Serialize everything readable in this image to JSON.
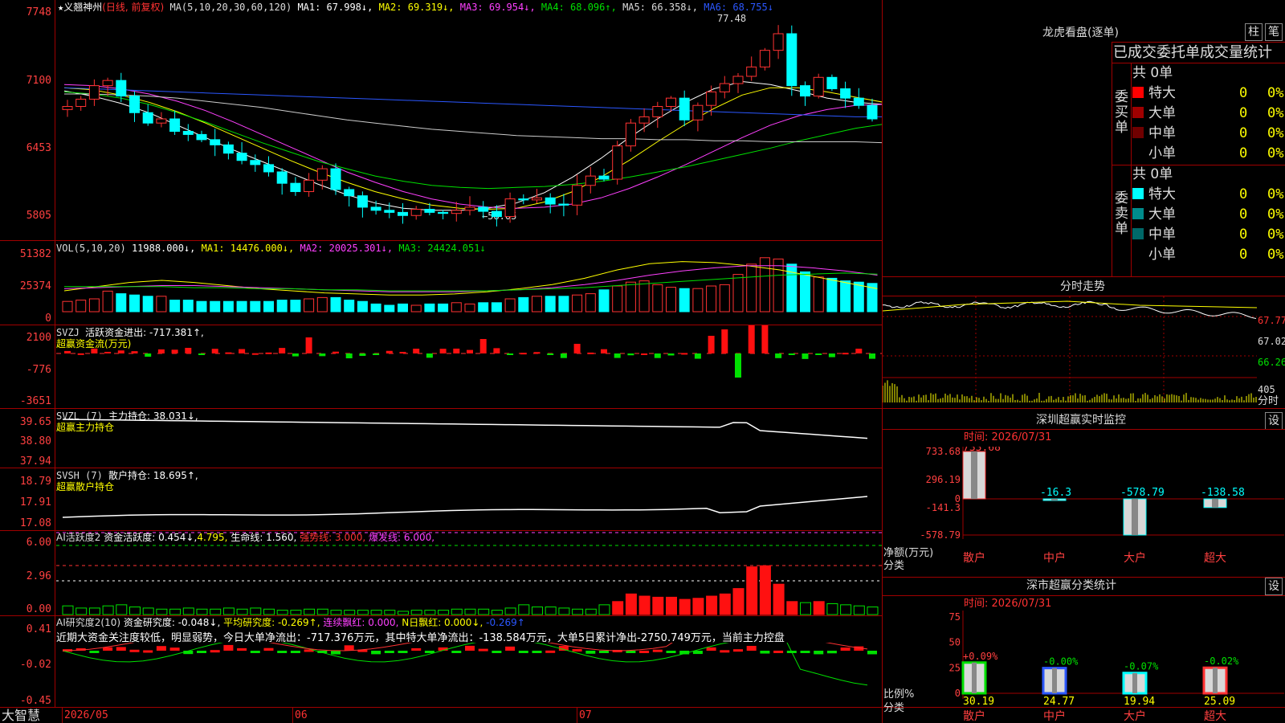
{
  "stock": {
    "name": "义翘神州",
    "mode": "(日线, 前复权)",
    "ma_label": "MA(5,10,20,30,60,120)",
    "ma": [
      {
        "label": "MA1: 67.998↓,",
        "color": "#ffffff"
      },
      {
        "label": "MA2: 69.319↓,",
        "color": "#ffff00"
      },
      {
        "label": "MA3: 69.954↓,",
        "color": "#ff40ff"
      },
      {
        "label": "MA4: 68.096↑,",
        "color": "#00e000"
      },
      {
        "label": "MA5: 66.358↓,",
        "color": "#dddddd"
      },
      {
        "label": "MA6: 68.755↓",
        "color": "#2b57ff"
      }
    ],
    "high_label": "77.48",
    "low_label": "←58.05",
    "star": "★"
  },
  "price_axis": [
    "7748",
    "7100",
    "6453",
    "5805"
  ],
  "vol": {
    "label": "VOL(5,10,20)",
    "v": "11988.000↓,",
    "ma1": "MA1: 14476.000↓,",
    "ma2": "MA2: 20025.301↓,",
    "ma3": "MA3: 24424.051↓",
    "axis": [
      "51382",
      "25374",
      "0"
    ]
  },
  "svzj": {
    "label": "SVZJ",
    "title": "活跃资金进出: -717.381↑,",
    "sub": "超赢资金流(万元)",
    "axis": [
      "2100",
      "-776",
      "-3651"
    ]
  },
  "svzl": {
    "label": "SVZL (7)",
    "title": "主力持仓: 38.031↓,",
    "sub": "超赢主力持仓",
    "axis": [
      "39.65",
      "38.80",
      "37.94"
    ]
  },
  "svsh": {
    "label": "SVSH (7)",
    "title": "散户持仓: 18.695↑,",
    "sub": "超赢散户持仓",
    "axis": [
      "18.79",
      "17.91",
      "17.08"
    ]
  },
  "ai1": {
    "label": "AI活跃度2",
    "a": "资金活跃度: 0.454↓,",
    "b": "4.795,",
    "c": "生命线: 1.560,",
    "d": "强势线: 3.000,",
    "e": "爆发线: 6.000,",
    "axis": [
      "6.00",
      "2.96",
      "0.00"
    ]
  },
  "ai2": {
    "label": "AI研究度2(10)",
    "a": "资金研究度: -0.048↓,",
    "b": "平均研究度: -0.269↑,",
    "c": "连续飘红: 0.000,",
    "d": "N日飘红: 0.000↓,",
    "e": "-0.269↑",
    "comment": "近期大资金关注度较低，明显弱势，今日大单净流出：-717.376万元，其中特大单净流出：-138.584万元，大单5日累计净出-2750.749万元，当前主力控盘",
    "axis": [
      "0.41",
      "-0.02",
      "-0.45"
    ]
  },
  "dates": [
    "2026/05",
    "06",
    "07"
  ],
  "logo": "大智慧",
  "right": {
    "lhkp": "龙虎看盘(逐单)",
    "btn_zhu": "柱",
    "btn_bi": "笔",
    "stats_title": "已成交委托单成交量统计",
    "buy_label": "委买单",
    "sell_label": "委卖单",
    "buy_total": "共 0单",
    "sell_total": "共 0单",
    "buy_rows": [
      {
        "name": "特大",
        "val": "0",
        "pct": "0%",
        "color": "#ff0000"
      },
      {
        "name": "大单",
        "val": "0",
        "pct": "0%",
        "color": "#a00000"
      },
      {
        "name": "中单",
        "val": "0",
        "pct": "0%",
        "color": "#700000"
      },
      {
        "name": "小单",
        "val": "0",
        "pct": "0%",
        "color": "#000000"
      }
    ],
    "sell_rows": [
      {
        "name": "特大",
        "val": "0",
        "pct": "0%",
        "color": "#00ffff"
      },
      {
        "name": "大单",
        "val": "0",
        "pct": "0%",
        "color": "#008c8c"
      },
      {
        "name": "中单",
        "val": "0",
        "pct": "0%",
        "color": "#006868"
      },
      {
        "name": "小单",
        "val": "0",
        "pct": "0%",
        "color": "#000000"
      }
    ],
    "fenshi_title": "分时走势",
    "fenshi_axis": [
      "67.77",
      "67.02",
      "66.26"
    ],
    "fenshi_vol": "405",
    "fenshi_unit": "分时",
    "sz_title": "深圳超赢实时监控",
    "sz_btn": "设",
    "sz_time": "时间: 2026/07/31",
    "sz_axis": [
      "733.68",
      "296.19",
      "0",
      "-141.3",
      "-578.79"
    ],
    "sz_bars": [
      {
        "label": "散户",
        "value": 733.68,
        "text": "733.68"
      },
      {
        "label": "中户",
        "value": -16.3,
        "text": "-16.3"
      },
      {
        "label": "大户",
        "value": -578.79,
        "text": "-578.79"
      },
      {
        "label": "超大",
        "value": -138.58,
        "text": "-138.58"
      }
    ],
    "sz_y1": "净额(万元)",
    "sz_y2": "分类",
    "fl_title": "深市超赢分类统计",
    "fl_btn": "设",
    "fl_time": "时间: 2026/07/31",
    "fl_axis": [
      "75",
      "50",
      "25",
      "0"
    ],
    "fl_bars": [
      {
        "label": "散户",
        "value": 30.19,
        "change": "+0.09%",
        "color": "#00e000"
      },
      {
        "label": "中户",
        "value": 24.77,
        "change": "-0.00%",
        "color": "#2b57ff"
      },
      {
        "label": "大户",
        "value": 19.94,
        "change": "-0.07%",
        "color": "#00ffff"
      },
      {
        "label": "超大",
        "value": 25.09,
        "change": "-0.02%",
        "color": "#ff3232"
      }
    ],
    "fl_y1": "比例%",
    "fl_y2": "分类"
  }
}
